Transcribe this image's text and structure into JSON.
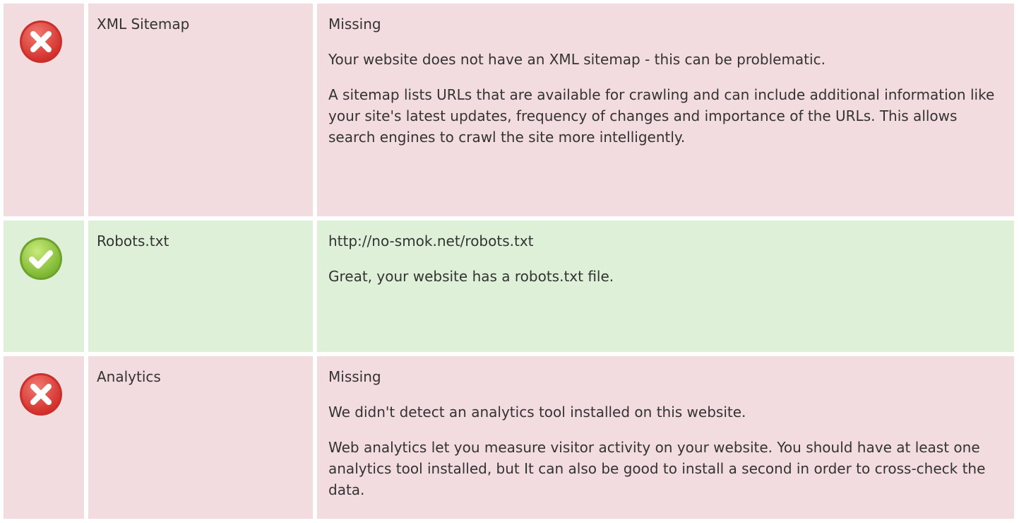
{
  "rows": [
    {
      "status": "fail",
      "icon": "error-x-icon",
      "name": "XML Sitemap",
      "value": "Missing",
      "paragraphs": [
        "Your website does not have an XML sitemap - this can be problematic.",
        "A sitemap lists URLs that are available for crawling and can include additional information like your site's latest updates, frequency of changes and importance of the URLs. This allows search engines to crawl the site more intelligently."
      ]
    },
    {
      "status": "pass",
      "icon": "success-check-icon",
      "name": "Robots.txt",
      "value": "http://no-smok.net/robots.txt",
      "paragraphs": [
        "Great, your website has a robots.txt file."
      ]
    },
    {
      "status": "fail",
      "icon": "error-x-icon",
      "name": "Analytics",
      "value": "Missing",
      "paragraphs": [
        "We didn't detect an analytics tool installed on this website.",
        "Web analytics let you measure visitor activity on your website. You should have at least one analytics tool installed, but It can also be good to install a second in order to cross-check the data."
      ]
    }
  ],
  "colors": {
    "fail_bg": "#f2dcdf",
    "pass_bg": "#dff0d8",
    "fail_icon": "#e0403a",
    "pass_icon": "#8cc63f"
  }
}
